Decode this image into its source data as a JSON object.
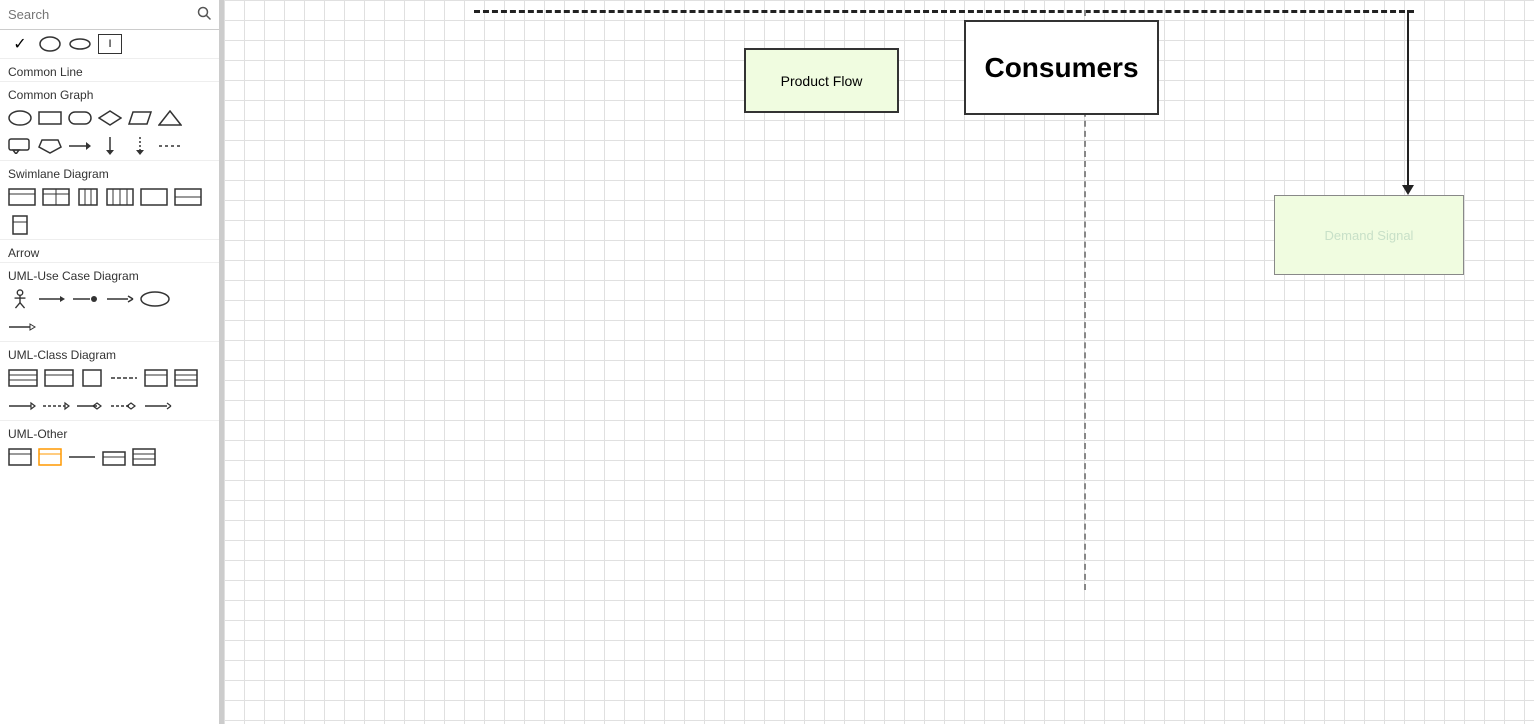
{
  "sidebar": {
    "search_placeholder": "Search",
    "sections": [
      {
        "id": "common-line",
        "label": "Common Line"
      },
      {
        "id": "common-graph",
        "label": "Common Graph"
      },
      {
        "id": "swimlane-diagram",
        "label": "Swimlane Diagram"
      },
      {
        "id": "arrow",
        "label": "Arrow"
      },
      {
        "id": "uml-use-case",
        "label": "UML-Use Case Diagram"
      },
      {
        "id": "uml-class",
        "label": "UML-Class Diagram"
      },
      {
        "id": "uml-other",
        "label": "UML-Other"
      }
    ]
  },
  "canvas": {
    "boxes": [
      {
        "id": "product-flow",
        "label": "Product Flow"
      },
      {
        "id": "consumers",
        "label": "Consumers"
      },
      {
        "id": "demand-signal",
        "label": "Demand Signal"
      }
    ]
  }
}
